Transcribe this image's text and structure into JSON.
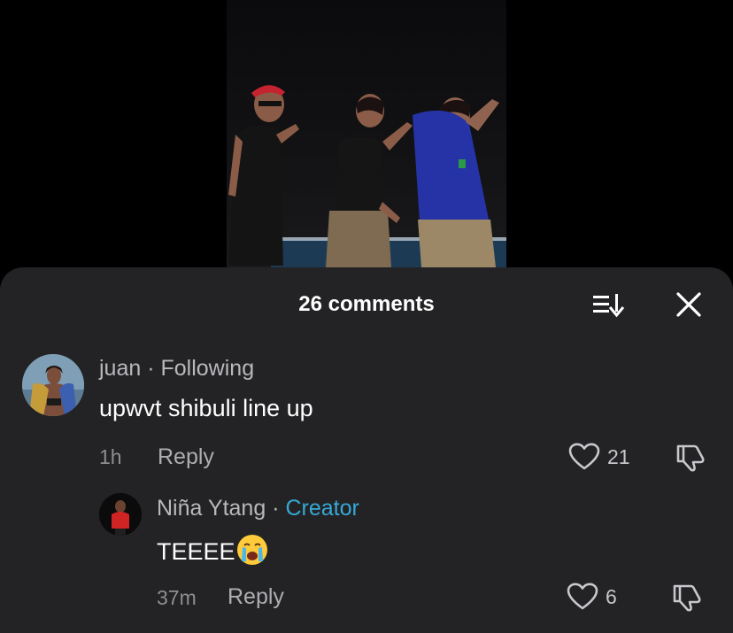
{
  "comments_sheet": {
    "title": "26 comments"
  },
  "comments": [
    {
      "author": "juan",
      "separator": "·",
      "status": "Following",
      "text": "upwvt shibuli line up",
      "time": "1h",
      "reply_label": "Reply",
      "likes": "21"
    }
  ],
  "replies": [
    {
      "author": "Niña Ytang",
      "separator": "·",
      "badge": "Creator",
      "text": "TEEEE",
      "emoji": "loudly-crying-face",
      "time": "37m",
      "reply_label": "Reply",
      "likes": "6"
    }
  ],
  "colors": {
    "sheet_bg": "#232325",
    "creator_accent": "#36a9d6",
    "muted_text": "#b9b9bd"
  }
}
